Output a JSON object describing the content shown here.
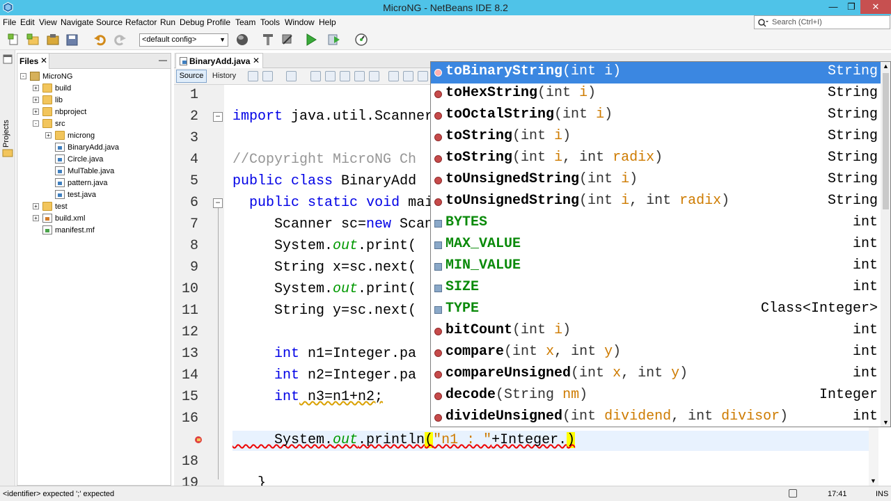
{
  "window": {
    "title": "MicroNG - NetBeans IDE 8.2"
  },
  "menu": [
    "File",
    "Edit",
    "View",
    "Navigate",
    "Source",
    "Refactor",
    "Run",
    "Debug",
    "Profile",
    "Team",
    "Tools",
    "Window",
    "Help"
  ],
  "search": {
    "placeholder": "Search (Ctrl+I)"
  },
  "toolbar": {
    "config": "<default config>"
  },
  "left_strip": {
    "label": "Projects"
  },
  "files_panel": {
    "tab_label": "Files",
    "tree": [
      {
        "label": "MicroNG",
        "kind": "project",
        "level": 0,
        "toggle": "-"
      },
      {
        "label": "build",
        "kind": "folder",
        "level": 1,
        "toggle": "+"
      },
      {
        "label": "lib",
        "kind": "folder",
        "level": 1,
        "toggle": "+"
      },
      {
        "label": "nbproject",
        "kind": "folder",
        "level": 1,
        "toggle": "+"
      },
      {
        "label": "src",
        "kind": "folder",
        "level": 1,
        "toggle": "-"
      },
      {
        "label": "microng",
        "kind": "folder",
        "level": 2,
        "toggle": "+"
      },
      {
        "label": "BinaryAdd.java",
        "kind": "java",
        "level": 2,
        "toggle": ""
      },
      {
        "label": "Circle.java",
        "kind": "java",
        "level": 2,
        "toggle": ""
      },
      {
        "label": "MulTable.java",
        "kind": "java",
        "level": 2,
        "toggle": ""
      },
      {
        "label": "pattern.java",
        "kind": "java",
        "level": 2,
        "toggle": ""
      },
      {
        "label": "test.java",
        "kind": "java",
        "level": 2,
        "toggle": ""
      },
      {
        "label": "test",
        "kind": "folder",
        "level": 1,
        "toggle": "+"
      },
      {
        "label": "build.xml",
        "kind": "xml",
        "level": 1,
        "toggle": "+"
      },
      {
        "label": "manifest.mf",
        "kind": "mf",
        "level": 1,
        "toggle": ""
      }
    ]
  },
  "editor": {
    "tab_label": "BinaryAdd.java",
    "source_label": "Source",
    "history_label": "History",
    "line_numbers": [
      "1",
      "2",
      "3",
      "4",
      "5",
      "6",
      "7",
      "8",
      "9",
      "10",
      "11",
      "12",
      "13",
      "14",
      "15",
      "16",
      "",
      "18",
      "19"
    ],
    "lines": [
      {
        "tokens": []
      },
      {
        "tokens": [
          {
            "t": "import",
            "c": "kw"
          },
          {
            "t": " java.util.Scanner;"
          }
        ]
      },
      {
        "tokens": []
      },
      {
        "tokens": [
          {
            "t": "//Copyright MicroNG Ch",
            "c": "cm"
          }
        ]
      },
      {
        "tokens": [
          {
            "t": "public",
            "c": "kw"
          },
          {
            "t": " "
          },
          {
            "t": "class",
            "c": "kw"
          },
          {
            "t": " BinaryAdd"
          }
        ]
      },
      {
        "tokens": [
          {
            "t": "  "
          },
          {
            "t": "public",
            "c": "kw"
          },
          {
            "t": " "
          },
          {
            "t": "static",
            "c": "kw"
          },
          {
            "t": " "
          },
          {
            "t": "void",
            "c": "kw"
          },
          {
            "t": " main"
          }
        ]
      },
      {
        "tokens": [
          {
            "t": "     Scanner sc="
          },
          {
            "t": "new",
            "c": "kw"
          },
          {
            "t": " Scanner"
          }
        ]
      },
      {
        "tokens": [
          {
            "t": "     System."
          },
          {
            "t": "out",
            "c": "fld"
          },
          {
            "t": ".print("
          }
        ]
      },
      {
        "tokens": [
          {
            "t": "     String x=sc.next("
          }
        ]
      },
      {
        "tokens": [
          {
            "t": "     System."
          },
          {
            "t": "out",
            "c": "fld"
          },
          {
            "t": ".print("
          }
        ]
      },
      {
        "tokens": [
          {
            "t": "     String y=sc.next("
          }
        ]
      },
      {
        "tokens": []
      },
      {
        "tokens": [
          {
            "t": "     "
          },
          {
            "t": "int",
            "c": "kw"
          },
          {
            "t": " n1=Integer.pa"
          }
        ]
      },
      {
        "tokens": [
          {
            "t": "     "
          },
          {
            "t": "int",
            "c": "kw"
          },
          {
            "t": " n2=Integer.pa"
          }
        ]
      },
      {
        "tokens": [
          {
            "t": "     "
          },
          {
            "t": "int",
            "c": "kw"
          },
          {
            "t": " n3=n1+n2;"
          }
        ]
      },
      {
        "tokens": []
      },
      {
        "tokens": [
          {
            "t": "     System."
          },
          {
            "t": "out",
            "c": "fld"
          },
          {
            "t": ".println"
          },
          {
            "t": "(",
            "c": "hl"
          },
          {
            "t": "\"n1 : \"",
            "c": "str"
          },
          {
            "t": "+Integer."
          },
          {
            "t": ")",
            "c": "hl"
          }
        ]
      },
      {
        "tokens": []
      },
      {
        "tokens": [
          {
            "t": "   }"
          }
        ]
      }
    ]
  },
  "completion": {
    "items": [
      {
        "name": "toBinaryString",
        "kind": "method",
        "params": [
          [
            "int",
            "i"
          ]
        ],
        "type": "String",
        "selected": true
      },
      {
        "name": "toHexString",
        "kind": "method",
        "params": [
          [
            "int",
            "i"
          ]
        ],
        "type": "String"
      },
      {
        "name": "toOctalString",
        "kind": "method",
        "params": [
          [
            "int",
            "i"
          ]
        ],
        "type": "String"
      },
      {
        "name": "toString",
        "kind": "method",
        "params": [
          [
            "int",
            "i"
          ]
        ],
        "type": "String"
      },
      {
        "name": "toString",
        "kind": "method",
        "params": [
          [
            "int",
            "i"
          ],
          [
            "int",
            "radix"
          ]
        ],
        "type": "String"
      },
      {
        "name": "toUnsignedString",
        "kind": "method",
        "params": [
          [
            "int",
            "i"
          ]
        ],
        "type": "String"
      },
      {
        "name": "toUnsignedString",
        "kind": "method",
        "params": [
          [
            "int",
            "i"
          ],
          [
            "int",
            "radix"
          ]
        ],
        "type": "String"
      },
      {
        "name": "BYTES",
        "kind": "field",
        "type": "int"
      },
      {
        "name": "MAX_VALUE",
        "kind": "field",
        "type": "int"
      },
      {
        "name": "MIN_VALUE",
        "kind": "field",
        "type": "int"
      },
      {
        "name": "SIZE",
        "kind": "field",
        "type": "int"
      },
      {
        "name": "TYPE",
        "kind": "field",
        "type": "Class<Integer>"
      },
      {
        "name": "bitCount",
        "kind": "method",
        "params": [
          [
            "int",
            "i"
          ]
        ],
        "type": "int"
      },
      {
        "name": "compare",
        "kind": "method",
        "params": [
          [
            "int",
            "x"
          ],
          [
            "int",
            "y"
          ]
        ],
        "type": "int"
      },
      {
        "name": "compareUnsigned",
        "kind": "method",
        "params": [
          [
            "int",
            "x"
          ],
          [
            "int",
            "y"
          ]
        ],
        "type": "int"
      },
      {
        "name": "decode",
        "kind": "method",
        "params": [
          [
            "String",
            "nm"
          ]
        ],
        "type": "Integer"
      },
      {
        "name": "divideUnsigned",
        "kind": "method",
        "params": [
          [
            "int",
            "dividend"
          ],
          [
            "int",
            "divisor"
          ]
        ],
        "type": "int"
      }
    ]
  },
  "status": {
    "message": "<identifier> expected ';' expected",
    "position": "17:41",
    "mode": "INS"
  },
  "colors": {
    "title_bar": "#4fc3e8",
    "selection": "#3b87e1",
    "keyword": "#0000e6",
    "field": "#009900",
    "string": "#ce7b00"
  }
}
